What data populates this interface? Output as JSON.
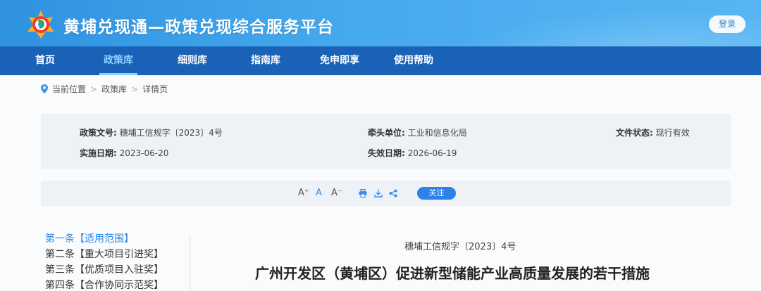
{
  "header": {
    "site_title": "黄埔兑现通—政策兑现综合服务平台",
    "login_label": "登录",
    "logo_icon": "logo-icon"
  },
  "nav": {
    "items": [
      {
        "label": "首页"
      },
      {
        "label": "政策库"
      },
      {
        "label": "细则库"
      },
      {
        "label": "指南库"
      },
      {
        "label": "免申即享"
      },
      {
        "label": "使用帮助"
      }
    ],
    "active_index": 1
  },
  "breadcrumb": {
    "icon": "location-pin-icon",
    "prefix": "当前位置",
    "items": [
      "政策库",
      "详情页"
    ]
  },
  "policy_info": {
    "doc_no_label": "政策文号:",
    "doc_no": "穗埔工信规字〔2023〕4号",
    "lead_unit_label": "牵头单位:",
    "lead_unit": "工业和信息化局",
    "status_label": "文件状态:",
    "status": "现行有效",
    "effective_label": "实施日期:",
    "effective_date": "2023-06-20",
    "expiry_label": "失效日期:",
    "expiry_date": "2026-06-19"
  },
  "toolbar": {
    "font_increase": "A⁺",
    "font_normal": "A",
    "font_decrease": "A⁻",
    "print_icon": "print-icon",
    "download_icon": "download-icon",
    "share_icon": "share-icon",
    "follow_label": "关注"
  },
  "toc": {
    "items": [
      {
        "label": "第一条【适用范围】"
      },
      {
        "label": "第二条【重大项目引进奖】"
      },
      {
        "label": "第三条【优质项目入驻奖】"
      },
      {
        "label": "第四条【合作协同示范奖】"
      }
    ],
    "active_index": 0
  },
  "document": {
    "doc_no": "穗埔工信规字〔2023〕4号",
    "title": "广州开发区（黄埔区）促进新型储能产业高质量发展的若干措施"
  },
  "colors": {
    "header_blue": "#3a9fe8",
    "nav_blue": "#1a62b7",
    "accent": "#2f88e6"
  }
}
